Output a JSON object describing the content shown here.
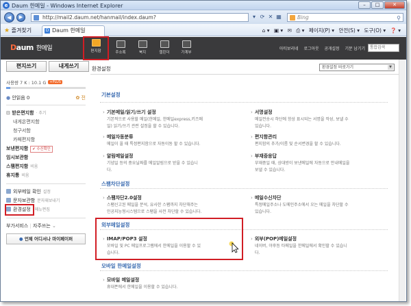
{
  "window": {
    "title": "Daum 한메일 - Windows Internet Explorer",
    "min": "–",
    "max": "□",
    "close": "✕"
  },
  "addressbar": {
    "url": "http://mail2.daum.net/hanmail/index.daum?",
    "search_placeholder": "Bing"
  },
  "favbar": {
    "favorites": "즐겨찾기",
    "tab_title": "Daum 한메일",
    "commands": [
      "페이지(P) ▾",
      "안전(S) ▾",
      "도구(O) ▾",
      "❓ ▾"
    ]
  },
  "daum": {
    "logo_d": "D",
    "logo_rest": "aum",
    "service": "한메일",
    "top_icons": [
      "편지함",
      "주소록",
      "북지",
      "캘린더",
      "가계부"
    ],
    "top_links": [
      "아티보리네",
      "로그아웃",
      "공개설정",
      "기분 남기기"
    ],
    "search_placeholder": "통합검색"
  },
  "sidebar": {
    "compose": "편지쓰기",
    "to_me": "내게쓰기",
    "usage": "사용량 7 K : 10.1 G",
    "usage_badge": "+PLUS",
    "usage_fraction": 0.05,
    "unread": "안읽음 0",
    "unread_count": "0",
    "folders": [
      {
        "label": "받은편지함",
        "extra": "· 추기",
        "bold": true
      },
      {
        "label": "내게온편지함",
        "sub": true
      },
      {
        "label": "청구서함",
        "sub": true
      },
      {
        "label": "카페편지함",
        "sub": true
      }
    ],
    "sent": "보낸편지함",
    "sent_check": "✔ 수신확인",
    "temp": "임시보관함",
    "spam": "스팸편지함",
    "spam_extra": "비움",
    "trash": "휴지통",
    "trash_extra": "비움",
    "external": "외부메일 확인",
    "external_extra": "설정",
    "mobile": "문자보관함",
    "mobile_extra": "문자재보내기",
    "settings": "환경설정",
    "settings_extra": "메뉴편집",
    "extra_services": "부가서비스",
    "frequent": "자주쓰는",
    "ondemand": "언제 어디서나 마이페이퍼"
  },
  "main": {
    "header": "환경설정",
    "select_label": "환경설정 바로가기",
    "sections": {
      "basic": "기본설정",
      "spam": "스팸차단설정",
      "external": "외부메일설정",
      "mobile": "모바일 한메일설정"
    },
    "items": [
      {
        "title": "기본메일/읽기/쓰기 설정",
        "desc": [
          "기본적으로 사용할 메일(한메일, 한메일express,키즈메",
          "일) 읽기/쓰기 관련 설정을 할 수 있습니다."
        ]
      },
      {
        "title": "서명설정",
        "desc": [
          "메일전송시 하단에 항상 표시되는 서명을 작성, 보낼 수",
          "있습니다."
        ]
      },
      {
        "title": "메일자동분류",
        "desc": [
          "메일이 올 때 특정편지함으로 자동이동 할 수 있습니다."
        ]
      },
      {
        "title": "편지함관리",
        "desc": [
          "편지함의 추가/이름 및 순서변경을 할 수 있습니다."
        ]
      },
      {
        "title": "알림메일설정",
        "desc": [
          "기념일 등의 중요날짜를 메일알림으로 받을 수 있습니",
          "다."
        ]
      },
      {
        "title": "부재중응답",
        "desc": [
          "부재중일 때, 상대방이 보낸메일에 자동으로 안내메일을",
          "보낼 수 있습니다."
        ]
      },
      {
        "title": "스팸차단2.0설정",
        "desc": [
          "스팸신고된 메일을 분석, 유사한 스팸까지 차단해주는",
          "인공지능형시스템으로 스팸을 사전 차단할 수 있습니다."
        ]
      },
      {
        "title": "메일수신차단",
        "desc": [
          "특정메일주소나 도메인주소에서 오는 메일을 차단할 수",
          "있습니다."
        ]
      },
      {
        "title": "IMAP/POP3 설정",
        "desc": [
          "모바일 및 PC 메일프로그램에서 한메일을 이용할 수 있",
          "습니다."
        ]
      },
      {
        "title": "외부(POP)메일설정",
        "desc": [
          "네이버, 야후등 타메일을 한메일에서 확인할 수 있습니",
          "다."
        ]
      },
      {
        "title": "모바일 메일설정",
        "desc": [
          "휴대폰에서 한메일을 이용할 수 있습니다."
        ]
      }
    ]
  },
  "colors": {
    "highlight": "#d11d24",
    "section_blue": "#3a6bb0",
    "header_dark": "#3a3a3c"
  }
}
